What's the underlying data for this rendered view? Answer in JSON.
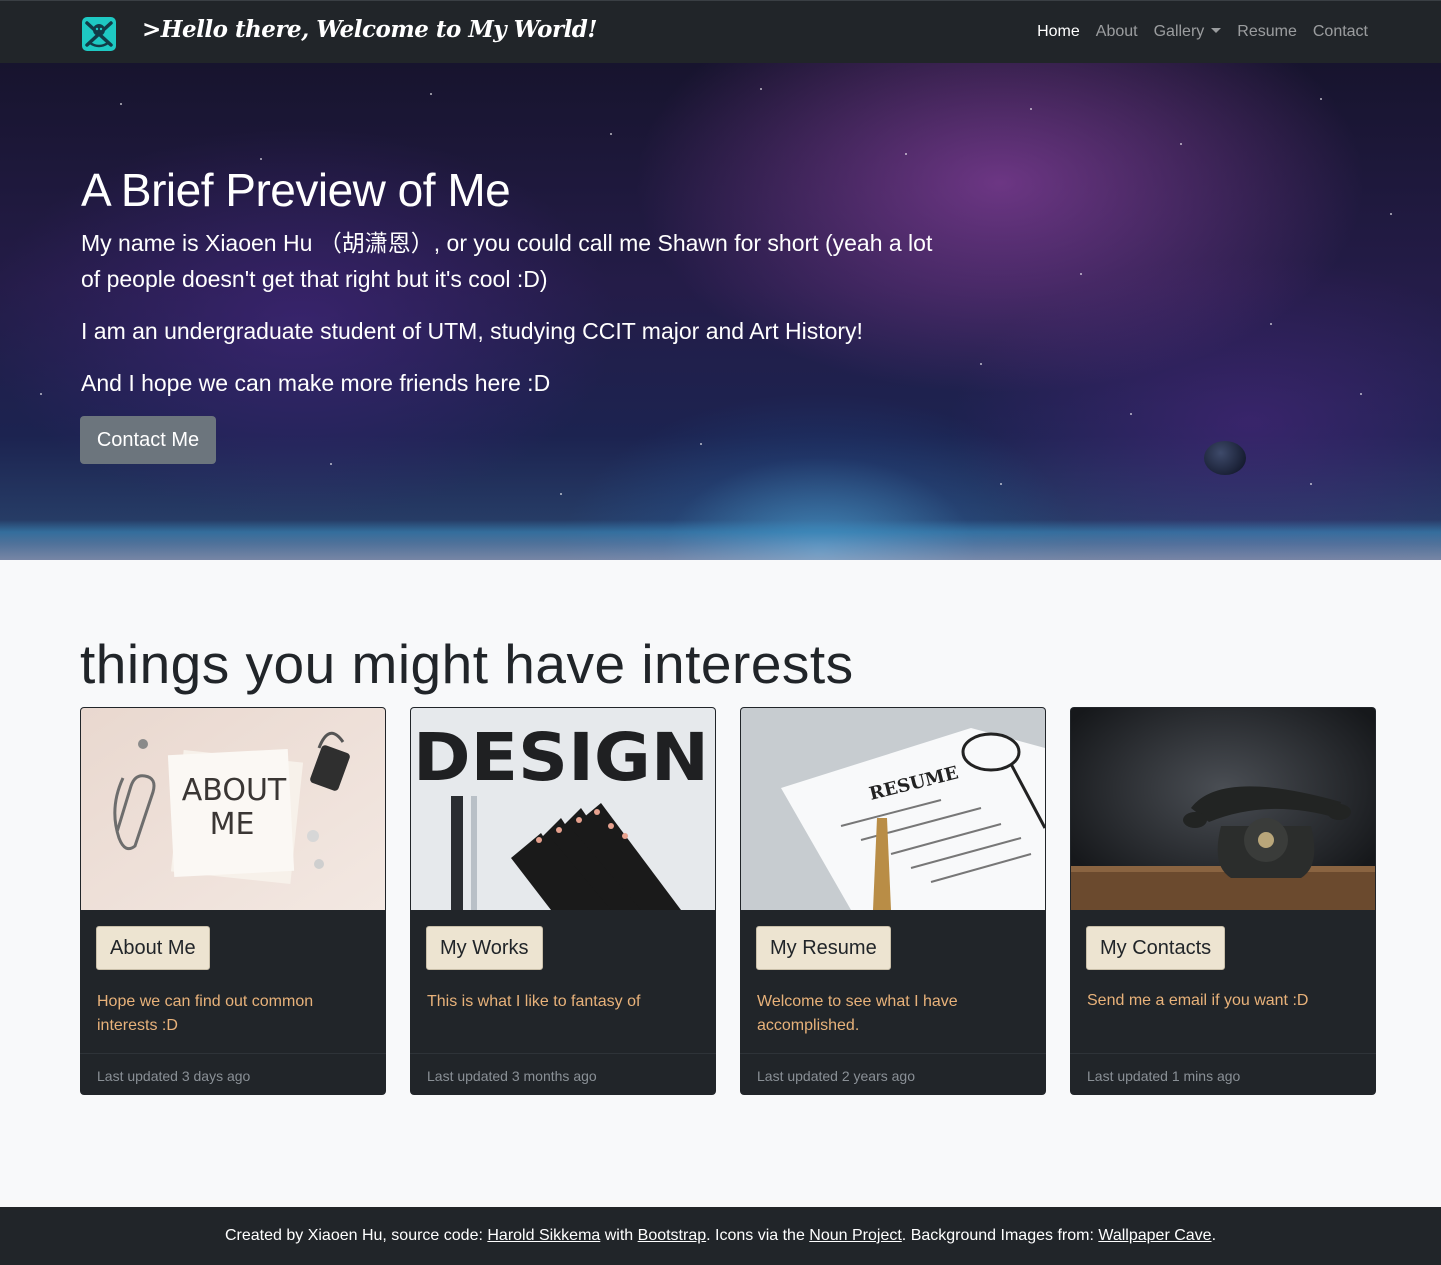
{
  "navbar": {
    "brand_title": ">Hello there, Welcome to My World!",
    "brand_logo_icon": "teal-shield-logo-icon",
    "items": [
      {
        "label": "Home",
        "active": true
      },
      {
        "label": "About"
      },
      {
        "label": "Gallery"
      },
      {
        "label": "Resume"
      },
      {
        "label": "Contact"
      }
    ]
  },
  "hero": {
    "title": "A Brief Preview of Me",
    "paragraphs": [
      "My name is Xiaoen Hu （胡潇恩）, or you could call me Shawn for short (yeah a lot of people doesn't get that right but it's cool :D)",
      "I am an undergraduate student of UTM, studying CCIT major and Art History!",
      "And I hope we can make more friends here :D"
    ],
    "cta_label": "Contact Me"
  },
  "interests": {
    "title": "things you might have interests",
    "cards": [
      {
        "button": "About Me",
        "text": "Hope we can find out common interests :D",
        "footer": "Last updated 3 days ago",
        "image_icon": "about-me-notes-image",
        "image_text": [
          "ABOUT",
          "ME"
        ]
      },
      {
        "button": "My Works",
        "text": "This is what I like to fantasy of",
        "footer": "Last updated 3 months ago",
        "image_icon": "design-pencils-image",
        "image_text": [
          "DESIGN"
        ]
      },
      {
        "button": "My Resume",
        "text": "Welcome to see what I have accomplished.",
        "footer": "Last updated 2 years ago",
        "image_icon": "resume-paper-image",
        "image_text": [
          "RESUME"
        ]
      },
      {
        "button": "My Contacts",
        "text": "Send me a email if you want :D",
        "footer": "Last updated 1 mins ago",
        "image_icon": "rotary-telephone-image"
      }
    ]
  },
  "footer": {
    "text_1": "Created by Xiaoen Hu, source code: ",
    "link_1": "Harold Sikkema",
    "text_2": " with ",
    "link_2": "Bootstrap",
    "text_3": ". Icons via the ",
    "link_3": "Noun Project",
    "text_4": ". Background Images from: ",
    "link_4": "Wallpaper Cave",
    "text_5": "."
  },
  "colors": {
    "navbar_bg": "#212529",
    "card_bg": "#212529",
    "card_text": "#e8b27a",
    "card_button_bg": "#ede4d1",
    "secondary_button": "#6c757d",
    "page_bg": "#f8f9fa"
  }
}
